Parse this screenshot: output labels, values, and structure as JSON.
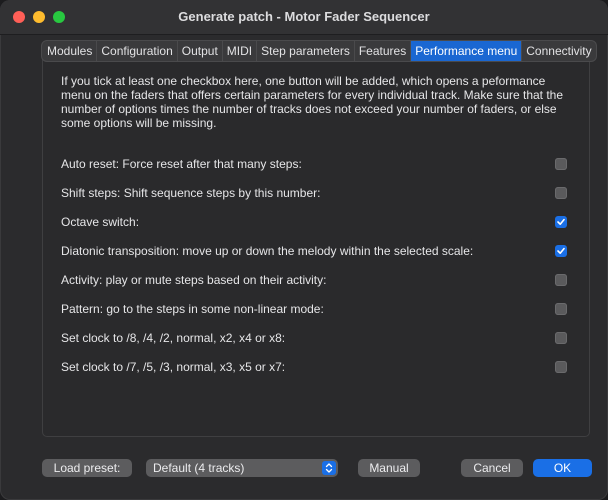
{
  "window": {
    "title": "Generate patch - Motor Fader Sequencer"
  },
  "tabs": [
    {
      "label": "Modules",
      "active": false
    },
    {
      "label": "Configuration",
      "active": false
    },
    {
      "label": "Output",
      "active": false
    },
    {
      "label": "MIDI",
      "active": false
    },
    {
      "label": "Step parameters",
      "active": false
    },
    {
      "label": "Features",
      "active": false
    },
    {
      "label": "Performance menu",
      "active": true
    },
    {
      "label": "Connectivity",
      "active": false
    }
  ],
  "intro": "If you tick at least one checkbox here, one button will be added, which opens a peformance menu on the faders that offers certain parameters for every individual track. Make sure that the number of options times the number of tracks does not exceed your number of faders, or else some options will be missing.",
  "options": [
    {
      "label": "Auto reset: Force reset after that many steps:",
      "checked": false
    },
    {
      "label": "Shift steps: Shift sequence steps by this number:",
      "checked": false
    },
    {
      "label": "Octave switch:",
      "checked": true
    },
    {
      "label": "Diatonic transposition: move up or down the melody within the selected scale:",
      "checked": true
    },
    {
      "label": "Activity: play or mute steps based on their activity:",
      "checked": false
    },
    {
      "label": "Pattern: go to the steps in some non-linear mode:",
      "checked": false
    },
    {
      "label": "Set clock to /8, /4, /2, normal, x2, x4 or x8:",
      "checked": false
    },
    {
      "label": "Set clock to /7, /5, /3, normal, x3, x5 or x7:",
      "checked": false
    }
  ],
  "footer": {
    "load_preset_label": "Load preset:",
    "preset_value": "Default (4 tracks)",
    "manual_label": "Manual",
    "cancel_label": "Cancel",
    "ok_label": "OK"
  },
  "colors": {
    "accent": "#1a6fe6",
    "background": "#2b2b2d"
  }
}
